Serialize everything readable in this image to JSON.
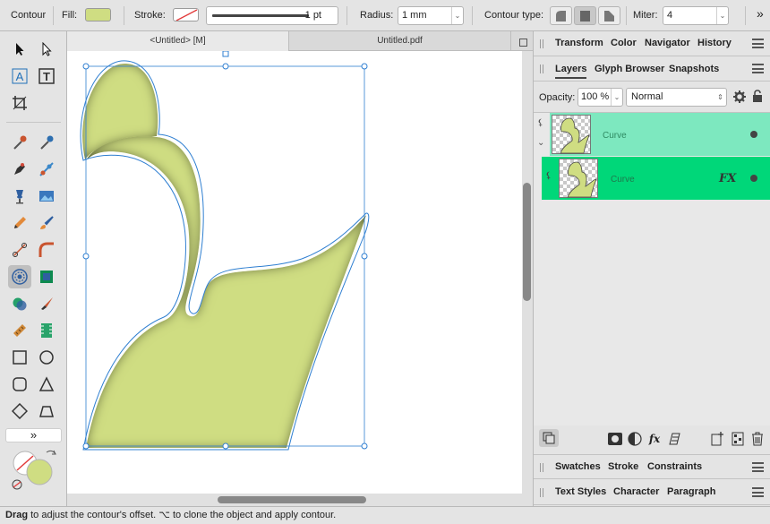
{
  "context_toolbar": {
    "tool_name": "Contour",
    "fill_label": "Fill:",
    "fill_color": "#cfdd82",
    "stroke_label": "Stroke:",
    "stroke_width": "1 pt",
    "radius_label": "Radius:",
    "radius_value": "1 mm",
    "contour_type_label": "Contour type:",
    "miter_label": "Miter:",
    "miter_value": "4",
    "overflow": "»"
  },
  "document_tabs": [
    {
      "label": "<Untitled> [M]",
      "active": true
    },
    {
      "label": "Untitled.pdf",
      "active": false
    }
  ],
  "panels_top": {
    "tabs": [
      "Transform",
      "Color",
      "Navigator",
      "History"
    ]
  },
  "layers_panel": {
    "tabs": [
      "Layers",
      "Glyph Browser",
      "Snapshots"
    ],
    "active_tab": "Layers",
    "opacity_label": "Opacity:",
    "opacity_value": "100 %",
    "blend_mode": "Normal",
    "layers": [
      {
        "name": "Curve",
        "fx": "",
        "color": "#7de8bf"
      },
      {
        "name": "Curve",
        "fx": "FX",
        "color": "#00d779"
      }
    ]
  },
  "panels_bottom1": {
    "tabs": [
      "Swatches",
      "Stroke",
      "Constraints"
    ]
  },
  "panels_bottom2": {
    "tabs": [
      "Text Styles",
      "Character",
      "Paragraph"
    ]
  },
  "tools_more": "»",
  "shape": {
    "fill": "#cfdd82",
    "stroke": "#2f7fd1"
  },
  "status": {
    "action": "Drag",
    "message": " to adjust the contour's offset. ⌥ to clone the object and apply contour."
  }
}
